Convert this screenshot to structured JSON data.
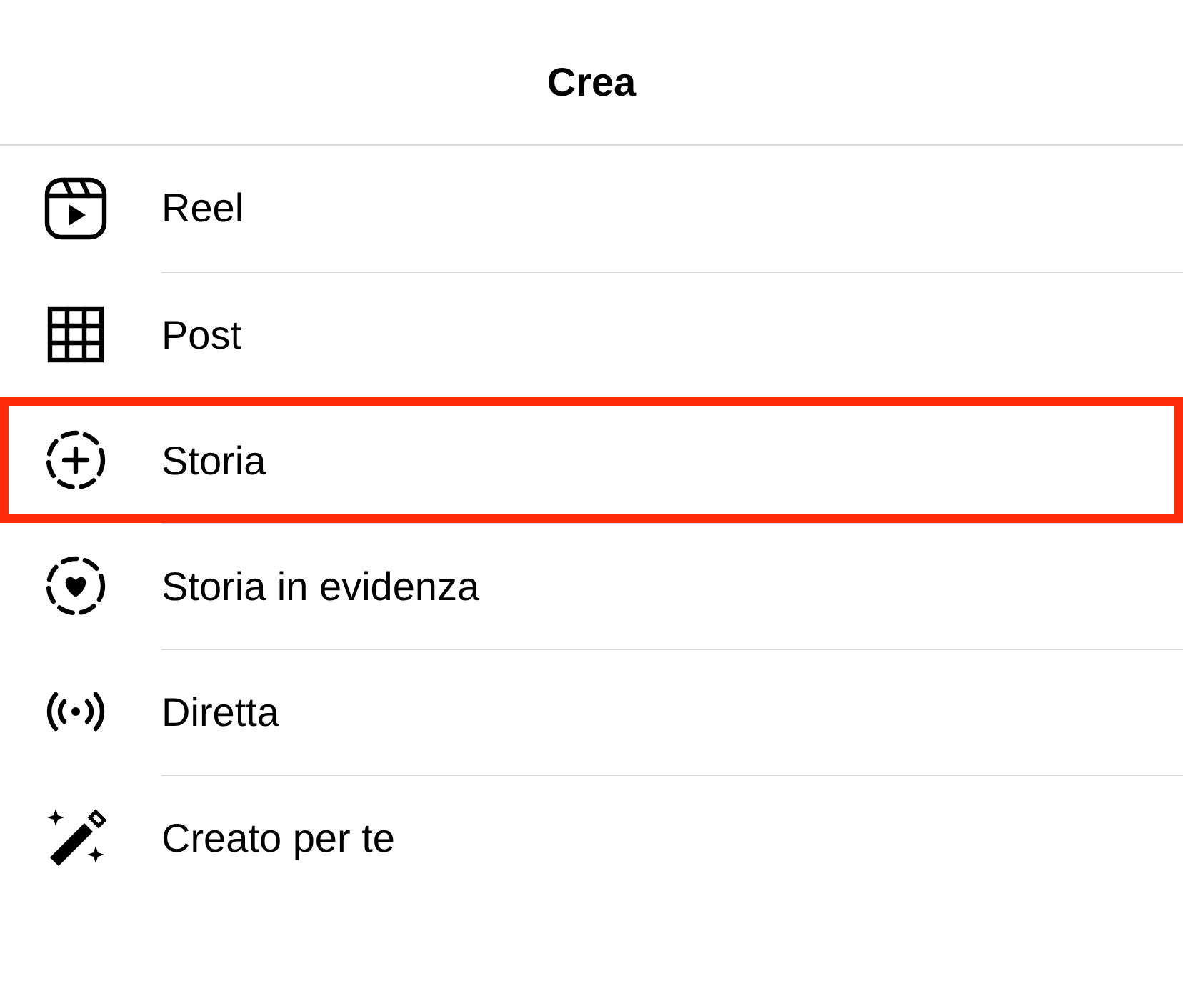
{
  "header": {
    "title": "Crea"
  },
  "items": [
    {
      "kind": "reel",
      "label": "Reel",
      "selected": false
    },
    {
      "kind": "post",
      "label": "Post",
      "selected": false
    },
    {
      "kind": "story",
      "label": "Storia",
      "selected": true
    },
    {
      "kind": "highlight",
      "label": "Storia in evidenza",
      "selected": false
    },
    {
      "kind": "live",
      "label": "Diretta",
      "selected": false
    },
    {
      "kind": "ai",
      "label": "Creato per te",
      "selected": false
    }
  ]
}
